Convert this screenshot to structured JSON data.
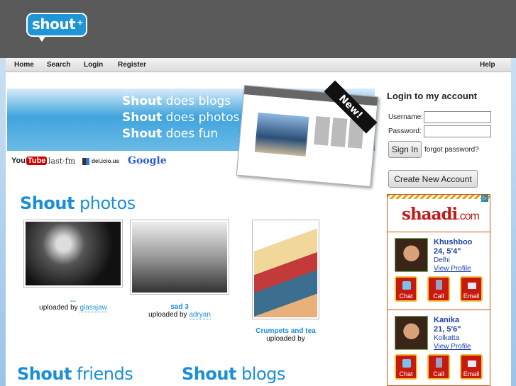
{
  "logo": {
    "text": "shout",
    "plus": "+"
  },
  "nav": {
    "home": "Home",
    "search": "Search",
    "login": "Login",
    "register": "Register",
    "help": "Help"
  },
  "banner": {
    "line1_bold": "Shout",
    "line1_rest": " does blogs",
    "line2_bold": "Shout",
    "line2_rest": " does photos",
    "line3_bold": "Shout",
    "line3_rest": " does fun",
    "new_tag": "New!"
  },
  "partners": {
    "youtube_a": "You",
    "youtube_b": "Tube",
    "lastfm": "last·fm",
    "delicious": "del.icio.us",
    "google": "Google"
  },
  "photos_section": {
    "bold": "Shout",
    "rest": " photos"
  },
  "photos": [
    {
      "title": "...",
      "uploaded_by_label": "uploaded by",
      "user": "glassjaw"
    },
    {
      "title": "sad 3",
      "uploaded_by_label": "uploaded by",
      "user": "adryan"
    },
    {
      "title": "Crumpets and tea",
      "uploaded_by_label": "uploaded by",
      "user": ""
    }
  ],
  "friends_section": {
    "bold": "Shout",
    "rest": " friends"
  },
  "blogs_section": {
    "bold": "Shout",
    "rest": " blogs"
  },
  "login": {
    "heading": "Login to my account",
    "username_label": "Username:",
    "password_label": "Password:",
    "signin_button": "Sign In",
    "forgot_link": "forgot password?",
    "create_button": "Create New Account"
  },
  "ad": {
    "brand": "shaadi",
    "brand_suffix": ".com",
    "profiles": [
      {
        "name": "Khushboo",
        "age_height": "24, 5'4\"",
        "city": "Delhi",
        "link": "View Profile",
        "chat": "Chat",
        "call": "Call",
        "email": "Email"
      },
      {
        "name": "Kanika",
        "age_height": "21, 5'6\"",
        "city": "Kolkatta",
        "link": "View Profile",
        "chat": "Chat",
        "call": "Call",
        "email": "Email"
      }
    ]
  },
  "colors": {
    "accent": "#1b8fd6",
    "topbar": "#5a5a5a",
    "ad_red": "#c8190f"
  }
}
